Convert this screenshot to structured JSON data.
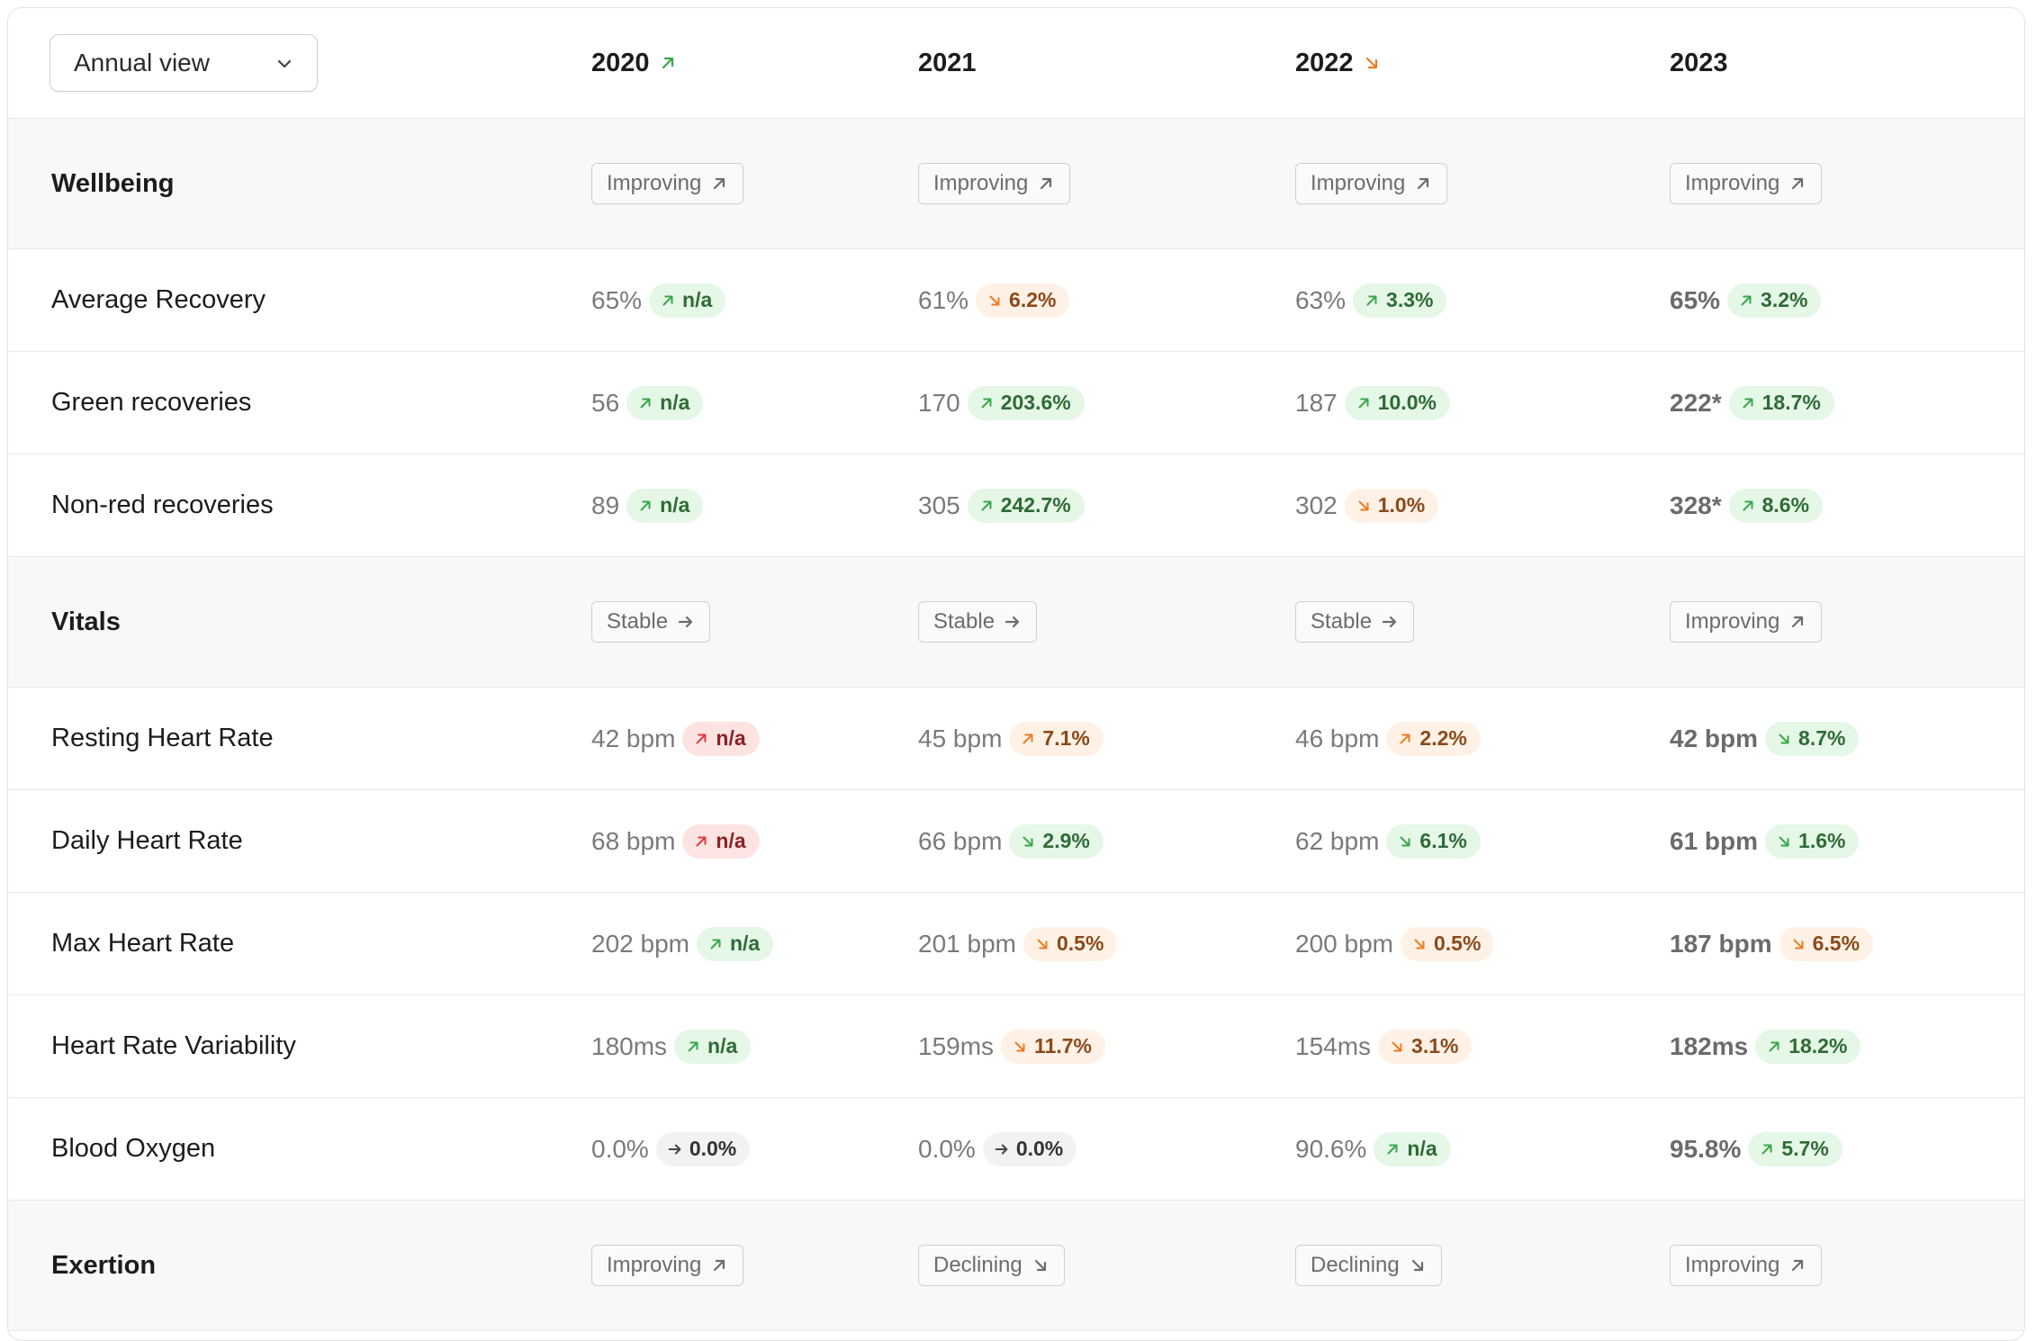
{
  "view_select": {
    "value": "Annual view"
  },
  "years": [
    {
      "label": "2020",
      "trend": "up"
    },
    {
      "label": "2021",
      "trend": "none"
    },
    {
      "label": "2022",
      "trend": "down"
    },
    {
      "label": "2023",
      "trend": "none"
    }
  ],
  "colors": {
    "good": "#36a84a",
    "warn": "#ee7b22",
    "bad": "#e0393a",
    "good_bg": "#e5f7e7",
    "warn_bg": "#fff1e5",
    "bad_bg": "#fde3e2"
  },
  "rows": [
    {
      "type": "section",
      "label": "Wellbeing",
      "cells": [
        {
          "status": "Improving",
          "icon": "arrow-up-right-icon"
        },
        {
          "status": "Improving",
          "icon": "arrow-up-right-icon"
        },
        {
          "status": "Improving",
          "icon": "arrow-up-right-icon"
        },
        {
          "status": "Improving",
          "icon": "arrow-up-right-icon"
        }
      ]
    },
    {
      "type": "metric",
      "label": "Average Recovery",
      "cells": [
        {
          "value": "65%",
          "change": "n/a",
          "dir": "up",
          "tone": "good"
        },
        {
          "value": "61%",
          "change": "6.2%",
          "dir": "down",
          "tone": "warn"
        },
        {
          "value": "63%",
          "change": "3.3%",
          "dir": "up",
          "tone": "good"
        },
        {
          "value": "65%",
          "change": "3.2%",
          "dir": "up",
          "tone": "good"
        }
      ]
    },
    {
      "type": "metric",
      "label": "Green recoveries",
      "cells": [
        {
          "value": "56",
          "change": "n/a",
          "dir": "up",
          "tone": "good"
        },
        {
          "value": "170",
          "change": "203.6%",
          "dir": "up",
          "tone": "good"
        },
        {
          "value": "187",
          "change": "10.0%",
          "dir": "up",
          "tone": "good"
        },
        {
          "value": "222*",
          "change": "18.7%",
          "dir": "up",
          "tone": "good"
        }
      ]
    },
    {
      "type": "metric",
      "label": "Non-red recoveries",
      "cells": [
        {
          "value": "89",
          "change": "n/a",
          "dir": "up",
          "tone": "good"
        },
        {
          "value": "305",
          "change": "242.7%",
          "dir": "up",
          "tone": "good"
        },
        {
          "value": "302",
          "change": "1.0%",
          "dir": "down",
          "tone": "warn"
        },
        {
          "value": "328*",
          "change": "8.6%",
          "dir": "up",
          "tone": "good"
        }
      ]
    },
    {
      "type": "section",
      "label": "Vitals",
      "cells": [
        {
          "status": "Stable",
          "icon": "arrow-right-icon"
        },
        {
          "status": "Stable",
          "icon": "arrow-right-icon"
        },
        {
          "status": "Stable",
          "icon": "arrow-right-icon"
        },
        {
          "status": "Improving",
          "icon": "arrow-up-right-icon"
        }
      ]
    },
    {
      "type": "metric",
      "label": "Resting Heart Rate",
      "cells": [
        {
          "value": "42 bpm",
          "change": "n/a",
          "dir": "up",
          "tone": "bad"
        },
        {
          "value": "45 bpm",
          "change": "7.1%",
          "dir": "up",
          "tone": "warn"
        },
        {
          "value": "46 bpm",
          "change": "2.2%",
          "dir": "up",
          "tone": "warn"
        },
        {
          "value": "42 bpm",
          "change": "8.7%",
          "dir": "down",
          "tone": "good"
        }
      ]
    },
    {
      "type": "metric",
      "label": "Daily Heart Rate",
      "cells": [
        {
          "value": "68 bpm",
          "change": "n/a",
          "dir": "up",
          "tone": "bad"
        },
        {
          "value": "66 bpm",
          "change": "2.9%",
          "dir": "down",
          "tone": "good"
        },
        {
          "value": "62 bpm",
          "change": "6.1%",
          "dir": "down",
          "tone": "good"
        },
        {
          "value": "61 bpm",
          "change": "1.6%",
          "dir": "down",
          "tone": "good"
        }
      ]
    },
    {
      "type": "metric",
      "label": "Max Heart Rate",
      "cells": [
        {
          "value": "202 bpm",
          "change": "n/a",
          "dir": "up",
          "tone": "good"
        },
        {
          "value": "201 bpm",
          "change": "0.5%",
          "dir": "down",
          "tone": "warn"
        },
        {
          "value": "200 bpm",
          "change": "0.5%",
          "dir": "down",
          "tone": "warn"
        },
        {
          "value": "187 bpm",
          "change": "6.5%",
          "dir": "down",
          "tone": "warn"
        }
      ]
    },
    {
      "type": "metric",
      "label": "Heart Rate Variability",
      "cells": [
        {
          "value": "180ms",
          "change": "n/a",
          "dir": "up",
          "tone": "good"
        },
        {
          "value": "159ms",
          "change": "11.7%",
          "dir": "down",
          "tone": "warn"
        },
        {
          "value": "154ms",
          "change": "3.1%",
          "dir": "down",
          "tone": "warn"
        },
        {
          "value": "182ms",
          "change": "18.2%",
          "dir": "up",
          "tone": "good"
        }
      ]
    },
    {
      "type": "metric",
      "label": "Blood Oxygen",
      "cells": [
        {
          "value": "0.0%",
          "change": "0.0%",
          "dir": "flat",
          "tone": "neutral"
        },
        {
          "value": "0.0%",
          "change": "0.0%",
          "dir": "flat",
          "tone": "neutral"
        },
        {
          "value": "90.6%",
          "change": "n/a",
          "dir": "up",
          "tone": "good"
        },
        {
          "value": "95.8%",
          "change": "5.7%",
          "dir": "up",
          "tone": "good"
        }
      ]
    },
    {
      "type": "section",
      "label": "Exertion",
      "cells": [
        {
          "status": "Improving",
          "icon": "arrow-up-right-icon"
        },
        {
          "status": "Declining",
          "icon": "arrow-down-right-icon"
        },
        {
          "status": "Declining",
          "icon": "arrow-down-right-icon"
        },
        {
          "status": "Improving",
          "icon": "arrow-up-right-icon"
        }
      ]
    }
  ]
}
